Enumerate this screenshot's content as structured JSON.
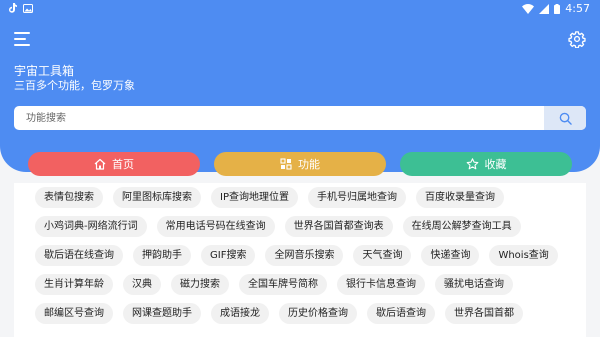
{
  "status": {
    "time": "4:57"
  },
  "app": {
    "title": "宇宙工具箱",
    "subtitle": "三百多个功能，包罗万象"
  },
  "search": {
    "placeholder": "功能搜索"
  },
  "tabs": [
    {
      "label": "首页",
      "icon": "home-icon",
      "color": "#f26161"
    },
    {
      "label": "功能",
      "icon": "grid-icon",
      "color": "#e5b147"
    },
    {
      "label": "收藏",
      "icon": "star-icon",
      "color": "#3dbf94"
    }
  ],
  "tools": [
    "表情包搜索",
    "阿里图标库搜索",
    "IP查询地理位置",
    "手机号归属地查询",
    "百度收录量查询",
    "小鸡词典-网络流行词",
    "常用电话号码在线查询",
    "世界各国首都查询表",
    "在线周公解梦查询工具",
    "歇后语在线查询",
    "押韵助手",
    "GIF搜索",
    "全网音乐搜索",
    "天气查询",
    "快递查询",
    "Whois查询",
    "生肖计算年龄",
    "汉典",
    "磁力搜索",
    "全国车牌号简称",
    "银行卡信息查询",
    "骚扰电话查询",
    "邮编区号查询",
    "网课查题助手",
    "成语接龙",
    "历史价格查询",
    "歇后语查询",
    "世界各国首都"
  ],
  "colors": {
    "header": "#4e8cf2",
    "background": "#f4f5f7"
  }
}
